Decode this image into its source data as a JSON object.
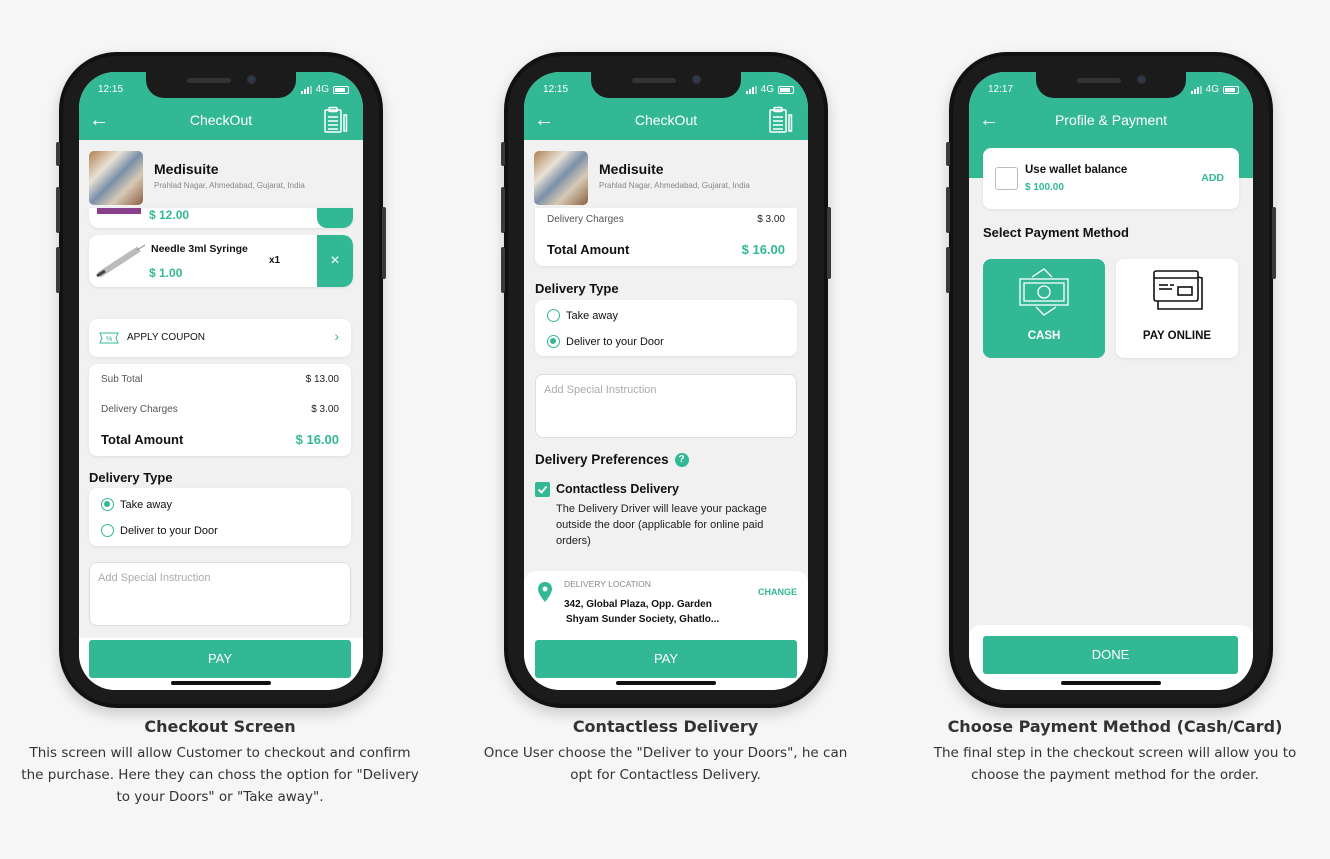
{
  "colors": {
    "accent": "#33b895",
    "background": "#f6f6f6"
  },
  "screens": [
    {
      "status": {
        "time": "12:15",
        "network": "4G"
      },
      "header": {
        "title": "CheckOut",
        "back_icon": "arrow-left",
        "right_icon": "clipboard-icon"
      },
      "store": {
        "name": "Medisuite",
        "address": "Prahlad Nagar, Ahmedabad, Gujarat, India"
      },
      "cart_items": [
        {
          "name": "",
          "price": "$ 12.00"
        },
        {
          "name": "Needle 3ml  Syringe",
          "price": "$ 1.00",
          "qty": "x1"
        }
      ],
      "coupon": {
        "label": "APPLY COUPON"
      },
      "summary": {
        "subtotal_label": "Sub Total",
        "subtotal": "$ 13.00",
        "delivery_label": "Delivery Charges",
        "delivery": "$ 3.00",
        "total_label": "Total Amount",
        "total": "$ 16.00"
      },
      "delivery_type": {
        "title": "Delivery Type",
        "options": [
          "Take away",
          "Deliver to your Door"
        ],
        "selected": "Take away"
      },
      "instruction_placeholder": "Add Special Instruction",
      "pay_label": "PAY"
    },
    {
      "status": {
        "time": "12:15",
        "network": "4G"
      },
      "header": {
        "title": "CheckOut"
      },
      "store": {
        "name": "Medisuite",
        "address": "Prahlad Nagar, Ahmedabad, Gujarat, India"
      },
      "summary": {
        "delivery_label": "Delivery Charges",
        "delivery": "$ 3.00",
        "total_label": "Total Amount",
        "total": "$ 16.00"
      },
      "delivery_type": {
        "title": "Delivery Type",
        "options": [
          "Take away",
          "Deliver to your Door"
        ],
        "selected": "Deliver to your Door"
      },
      "instruction_placeholder": "Add Special Instruction",
      "preferences": {
        "title": "Delivery Preferences",
        "contactless_label": "Contactless Delivery",
        "contactless_checked": true,
        "description": "The Delivery Driver will leave your package outside the door (applicable for online paid orders)"
      },
      "location": {
        "label": "DELIVERY LOCATION",
        "change": "CHANGE",
        "line1": "342, Global Plaza, Opp. Garden",
        "line2": "Shyam Sunder Society,  Ghatlo..."
      },
      "pay_label": "PAY"
    },
    {
      "status": {
        "time": "12:17",
        "network": "4G"
      },
      "header": {
        "title": "Profile & Payment"
      },
      "wallet": {
        "label": "Use wallet balance",
        "amount": "$ 100.00",
        "add": "ADD",
        "checked": false
      },
      "payment": {
        "title": "Select Payment Method",
        "methods": [
          "CASH",
          "PAY ONLINE"
        ],
        "selected": "CASH"
      },
      "done_label": "DONE"
    }
  ],
  "captions": [
    {
      "title": "Checkout Screen",
      "text": "This screen will allow Customer to checkout and confirm the purchase. Here they can choss the option for \"Delivery to your Doors\" or \"Take away\"."
    },
    {
      "title": "Contactless Delivery",
      "text": "Once User choose the \"Deliver to your Doors\", he can opt for Contactless Delivery."
    },
    {
      "title": "Choose Payment Method (Cash/Card)",
      "text": "The final step in the checkout screen will allow you to choose the payment method for the order."
    }
  ]
}
